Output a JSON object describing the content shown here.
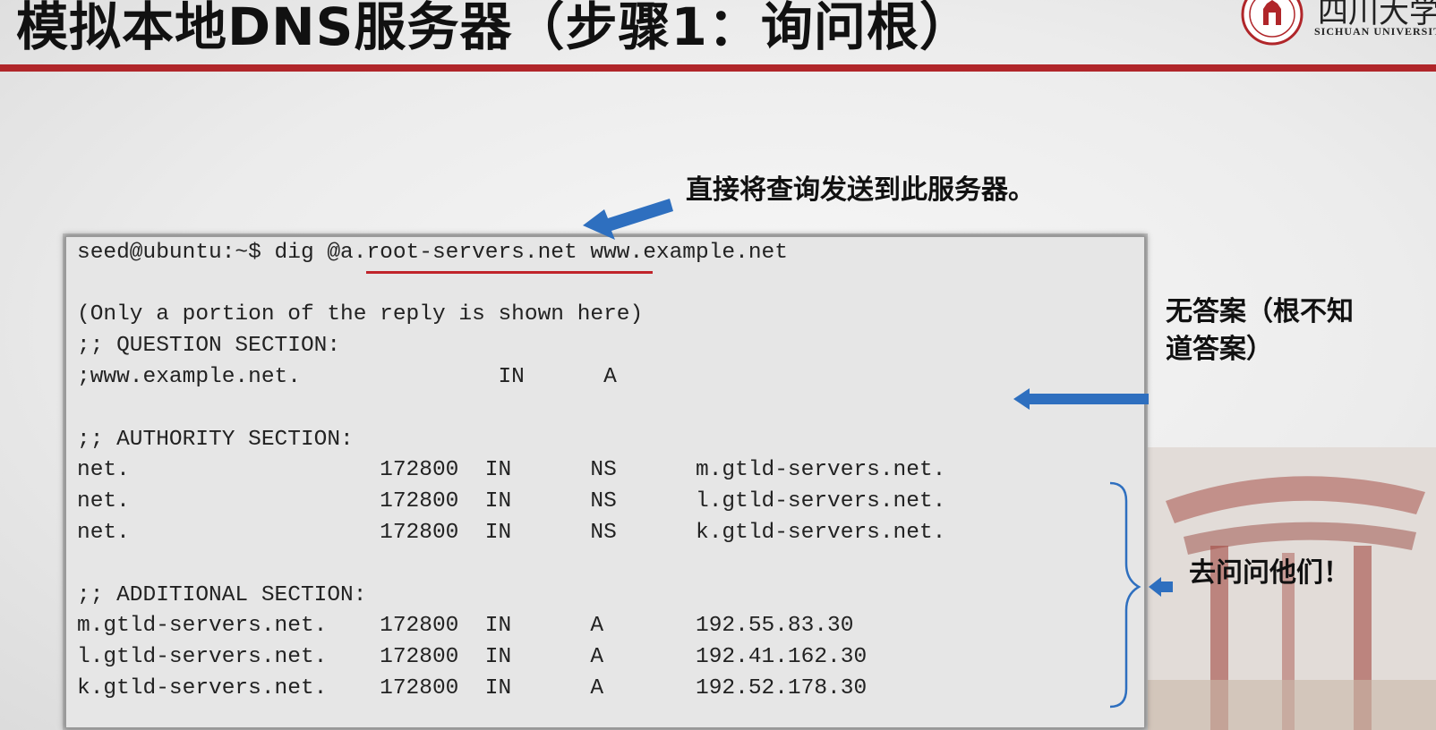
{
  "slide": {
    "title": "模拟本地DNS服务器（步骤1：询问根）",
    "accent_color": "#b0262a",
    "logo_cn": "四川大学",
    "logo_en": "SICHUAN UNIVERSITY"
  },
  "terminal": {
    "lines": [
      "seed@ubuntu:~$ dig @a.root-servers.net www.example.net",
      "",
      "(Only a portion of the reply is shown here)",
      ";; QUESTION SECTION:",
      ";www.example.net.               IN      A",
      "",
      ";; AUTHORITY SECTION:",
      "net.                   172800  IN      NS      m.gtld-servers.net.",
      "net.                   172800  IN      NS      l.gtld-servers.net.",
      "net.                   172800  IN      NS      k.gtld-servers.net.",
      "",
      ";; ADDITIONAL SECTION:",
      "m.gtld-servers.net.    172800  IN      A       192.55.83.30",
      "l.gtld-servers.net.    172800  IN      A       192.41.162.30",
      "k.gtld-servers.net.    172800  IN      A       192.52.178.30"
    ]
  },
  "annotations": {
    "direct_query": "直接将查询发送到此服务器。",
    "no_answer_line1": "无答案（根不知",
    "no_answer_line2": "道答案）",
    "ask_them": "去问问他们！",
    "arrow_color": "#2e6fbf"
  }
}
